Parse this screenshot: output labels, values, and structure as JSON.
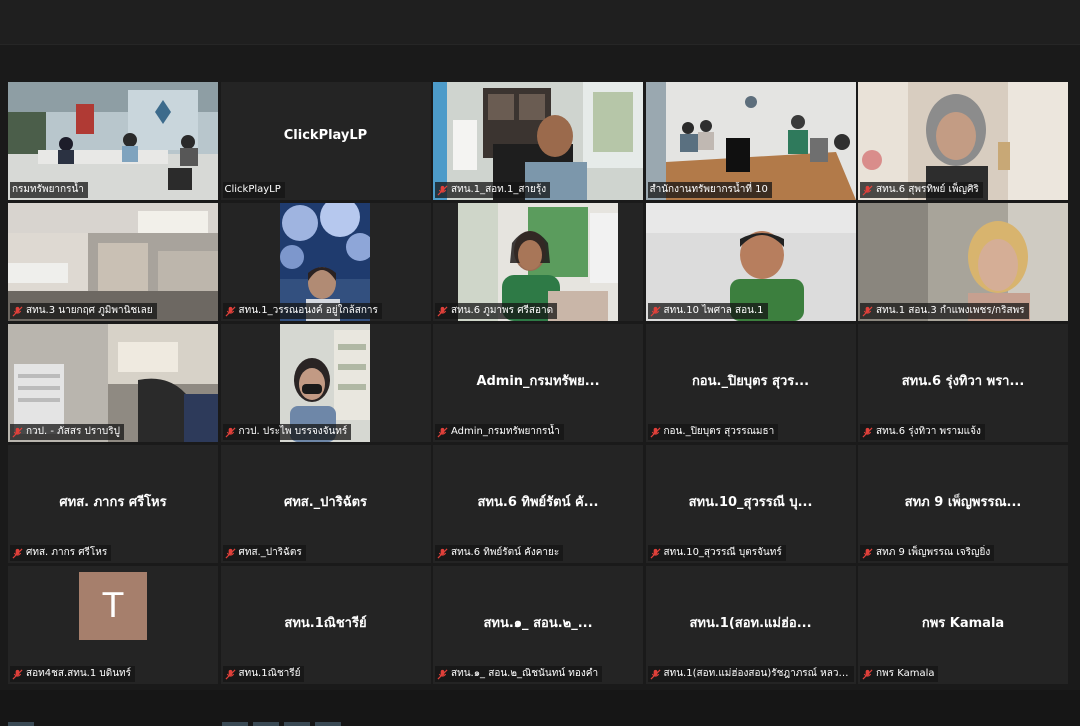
{
  "meeting": {
    "tiles": [
      {
        "label": "กรมทรัพยากรน้ำ",
        "scene": "room"
      },
      {
        "label": "ClickPlayLP",
        "center": "ClickPlayLP"
      },
      {
        "label": "สทน.1_สอท.1_สายรุ้ง",
        "scene": "man"
      },
      {
        "label": "สำนักงานทรัพยากรน้ำที่ 10",
        "scene": "meeting"
      },
      {
        "label": "สทน.6 สุพรทิพย์ เพ็ญศิริ",
        "scene": "woman"
      },
      {
        "label": "สทน.3 นายกฤศ ภูมิพานิชเลย",
        "scene": "office"
      },
      {
        "label": "สทน.1_วรรณอนงค์ อยู่ใกล้สการ",
        "scene": "blossom"
      },
      {
        "label": "สทน.6 ภูมาพร ศรีสอาด",
        "scene": "green"
      },
      {
        "label": "สทน.10 ไพศาล สอน.1",
        "scene": "man2"
      },
      {
        "label": "สทน.1 สอน.3 กำแพงเพชร/กริสพร",
        "scene": "woman2"
      },
      {
        "label": "กวป. - ภัสสร ปราบริปู",
        "scene": "shelves"
      },
      {
        "label": "กวป. ประไพ บรรจงจันทร์",
        "scene": "mask"
      },
      {
        "label": "Admin_กรมทรัพยากรน้ำ",
        "center": "Admin_กรมทรัพย..."
      },
      {
        "label": "กอน._ปิยบุตร สุวรรณมธา",
        "center": "กอน._ปิยบุตร สุวร..."
      },
      {
        "label": "สทน.6 รุ่งทิวา พรามแจ้ง",
        "center": "สทน.6 รุ่งทิวา พรา..."
      },
      {
        "label": "ศทส. ภากร ศรีโหร",
        "center": "ศทส. ภากร ศรีโหร"
      },
      {
        "label": "ศทส._ปาริฉัตร",
        "center": "ศทส._ปาริฉัตร"
      },
      {
        "label": "สทน.6 ทิพย์รัตน์ คังคายะ",
        "center": "สทน.6 ทิพย์รัตน์ คั..."
      },
      {
        "label": "สทน.10_สุวรรณี บุตรจันทร์",
        "center": "สทน.10_สุวรรณี บุ..."
      },
      {
        "label": "สทภ 9 เพ็ญพรรณ เจริญยิ่ง",
        "center": "สทภ 9 เพ็ญพรรณ..."
      },
      {
        "label": "สอท4ชส.สทน.1 บดินทร์",
        "avatar": "T"
      },
      {
        "label": "สทน.1ณิชารีย์",
        "center": "สทน.1ณิชารีย์"
      },
      {
        "label": "สทน.๑_ สอน.๒_ณิชนันทน์ ทองคำ",
        "center": "สทน.๑_ สอน.๒_..."
      },
      {
        "label": "สทน.1(สอท.แม่ฮ่องสอน)รัชฎาภรณ์ หลวง...",
        "center": "สทน.1(สอท.แม่ฮ่อ..."
      },
      {
        "label": "กพร Kamala",
        "center": "กพร Kamala"
      }
    ]
  },
  "colors": {
    "background": "#1a1a1a",
    "tile": "#242424",
    "active_border": "#d9cf6a",
    "mic_muted": "#e0403a",
    "avatar": "#a67f6c"
  }
}
